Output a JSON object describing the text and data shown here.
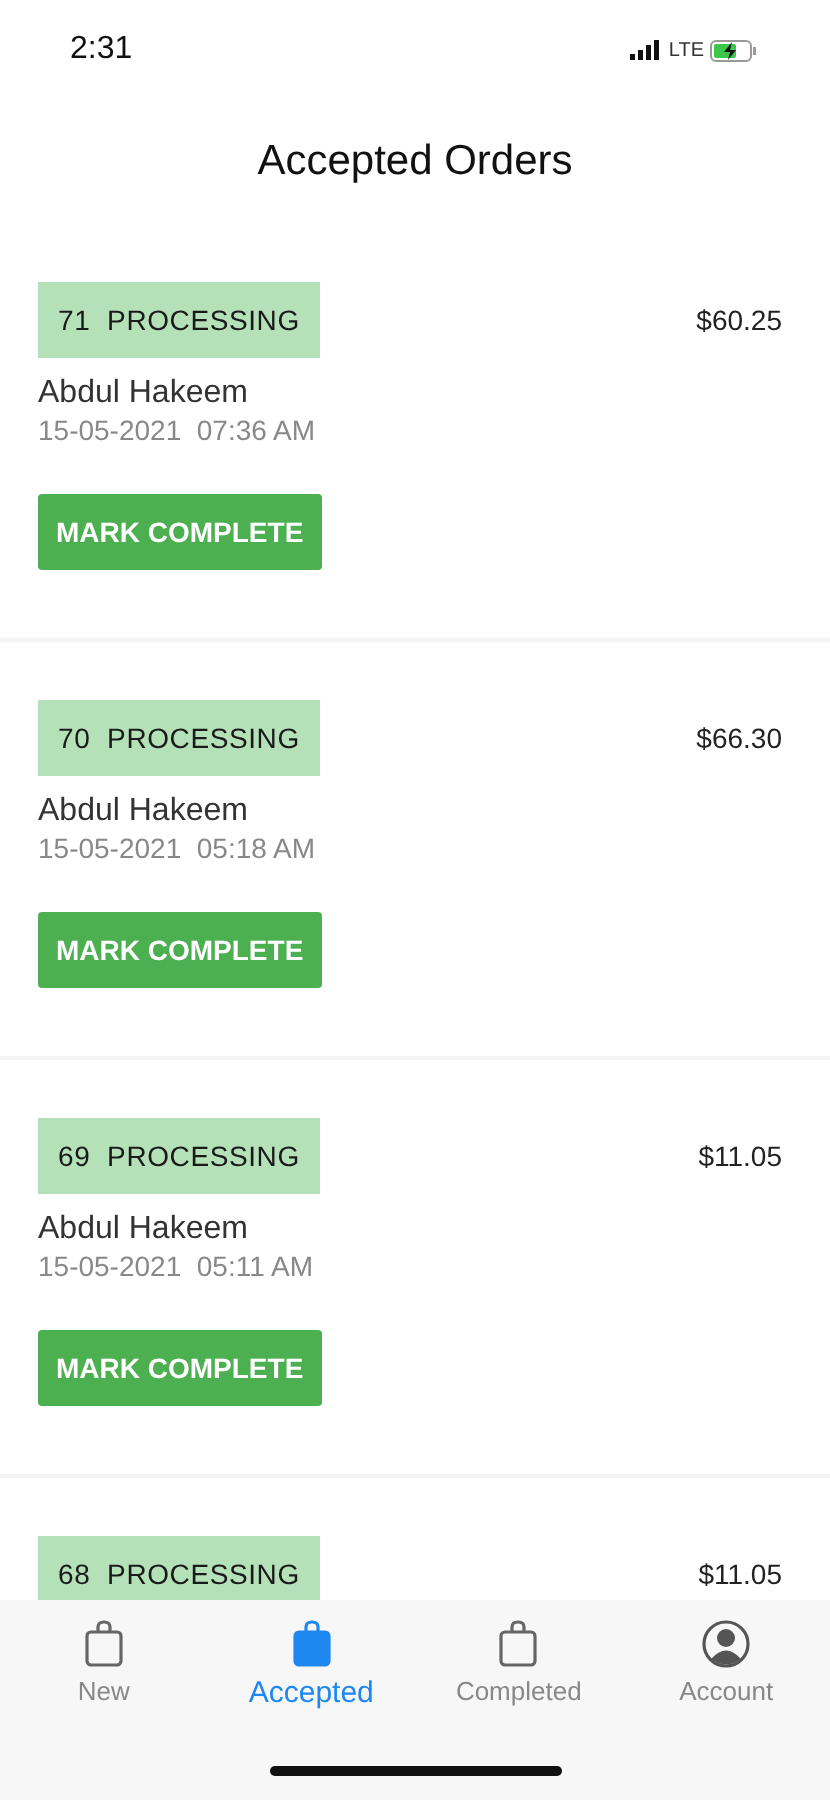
{
  "status_bar": {
    "time": "2:31",
    "network": "LTE"
  },
  "title": "Accepted Orders",
  "orders": [
    {
      "number": "71",
      "status": "PROCESSING",
      "price": "$60.25",
      "customer": "Abdul Hakeem",
      "date": "15-05-2021",
      "time": "07:36 AM",
      "action": "MARK COMPLETE"
    },
    {
      "number": "70",
      "status": "PROCESSING",
      "price": "$66.30",
      "customer": "Abdul Hakeem",
      "date": "15-05-2021",
      "time": "05:18 AM",
      "action": "MARK COMPLETE"
    },
    {
      "number": "69",
      "status": "PROCESSING",
      "price": "$11.05",
      "customer": "Abdul Hakeem",
      "date": "15-05-2021",
      "time": "05:11 AM",
      "action": "MARK COMPLETE"
    },
    {
      "number": "68",
      "status": "PROCESSING",
      "price": "$11.05"
    }
  ],
  "tabs": [
    {
      "label": "New",
      "kind": "bag",
      "selected": false
    },
    {
      "label": "Accepted",
      "kind": "bag",
      "selected": true
    },
    {
      "label": "Completed",
      "kind": "bag",
      "selected": false
    },
    {
      "label": "Account",
      "kind": "person",
      "selected": false
    }
  ]
}
